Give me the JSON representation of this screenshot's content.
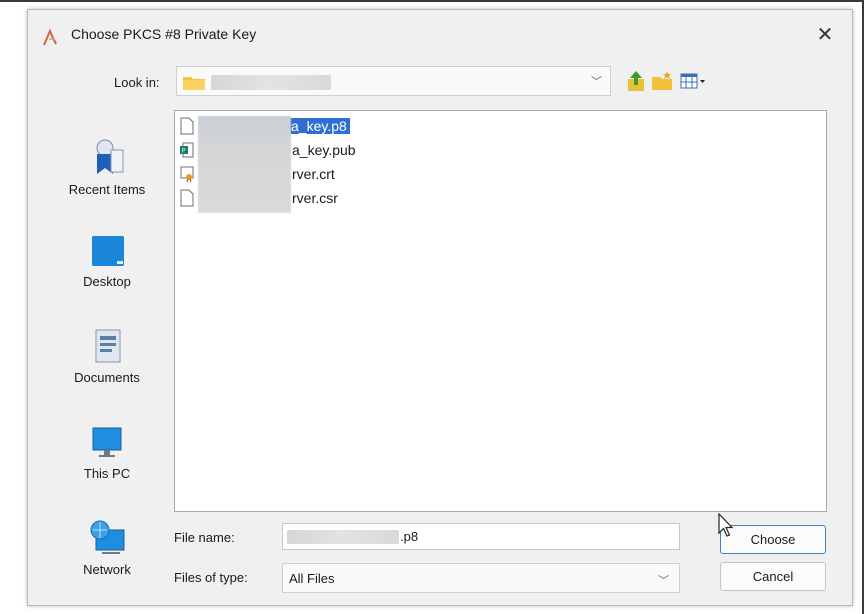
{
  "dialog": {
    "title": "Choose PKCS #8 Private Key",
    "close_glyph": "✕"
  },
  "lookin": {
    "label": "Look in:",
    "icons": [
      "folder-icon",
      "up-folder-icon",
      "new-folder-icon",
      "view-menu-icon"
    ]
  },
  "places": [
    {
      "label": "Recent Items",
      "icon": "recent-items-icon"
    },
    {
      "label": "Desktop",
      "icon": "desktop-icon"
    },
    {
      "label": "Documents",
      "icon": "documents-icon"
    },
    {
      "label": "This PC",
      "icon": "this-pc-icon"
    },
    {
      "label": "Network",
      "icon": "network-icon"
    }
  ],
  "files": [
    {
      "name": "a_key.p8",
      "icon": "file-icon",
      "selected": true
    },
    {
      "name": "a_key.pub",
      "icon": "publisher-file-icon",
      "selected": false
    },
    {
      "name": "rver.crt",
      "icon": "certificate-icon",
      "selected": false
    },
    {
      "name": "rver.csr",
      "icon": "file-icon",
      "selected": false
    }
  ],
  "form": {
    "file_name_label": "File name:",
    "file_name_value": ".p8",
    "files_of_type_label": "Files of type:",
    "files_of_type_value": "All Files"
  },
  "buttons": {
    "choose": "Choose",
    "cancel": "Cancel"
  },
  "colors": {
    "selection": "#2f6fd1",
    "dialog_bg": "#f0f0f0",
    "default_button_border": "#3c7fd1"
  }
}
